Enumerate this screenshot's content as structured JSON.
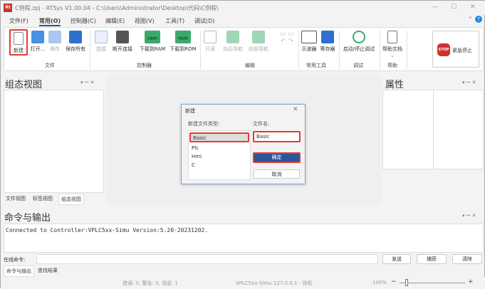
{
  "window": {
    "title": "C例程.zpj - RTSys V1.00.04 - C:\\Users\\Administrator\\Desktop\\代码\\C例程\\",
    "logo": "Rt"
  },
  "menu": [
    "文件(F)",
    "常用(O)",
    "控制器(C)",
    "编辑(E)",
    "视图(V)",
    "工具(T)",
    "调试(D)"
  ],
  "ribbon": {
    "file": {
      "label": "文件",
      "new": "新建",
      "open": "打开...",
      "save": "保存",
      "save_all": "保存所有"
    },
    "controller": {
      "label": "控制器",
      "connect": "连接",
      "disconnect": "断开连接",
      "download_ram": "下载到RAM",
      "download_rom": "下载到ROM",
      "ram": "ram",
      "rom": "rom"
    },
    "edit": {
      "label": "编辑",
      "readonly": "只读",
      "back": "向后导航",
      "forward": "向前导航"
    },
    "tools": {
      "label": "常用工具",
      "scope": "示波器",
      "register": "寄存器"
    },
    "debug": {
      "label": "调试",
      "toggle": "启动/停止调试"
    },
    "help": {
      "label": "帮助",
      "docs": "帮助文档"
    },
    "estop": {
      "label": "紧急停止",
      "badge": "STOP"
    }
  },
  "left_panel": {
    "title": "组态视图",
    "tabs": [
      "文件视图",
      "标签视图",
      "组态视图"
    ]
  },
  "right_panel": {
    "title": "属性"
  },
  "dialog": {
    "title": "新建",
    "type_label": "新建文件类型:",
    "types": [
      "Basic",
      "Plc",
      "Hmi",
      "C"
    ],
    "name_label": "文件名:",
    "name_value": "Basic",
    "ok": "确定",
    "cancel": "取消"
  },
  "output": {
    "title": "命令与输出",
    "text": "Connected to Controller:VPLC5xx-Simu Version:5.20-20231202.",
    "cmd_label": "在线命令:",
    "cmd_value": "",
    "send": "发送",
    "capture": "捕获",
    "clear": "清除",
    "tabs": [
      "命令与输出",
      "查找结果"
    ]
  },
  "status": {
    "messages": "错误: 0, 警告: 0, 消息: 1",
    "connection": "VPLC5xx-Simu:127.0.0.1 - 待机",
    "zoom": "100%",
    "zoom_value": 100
  },
  "colors": {
    "accent": "#2b579a",
    "highlight": "#e53935",
    "green": "#3aaa6b"
  }
}
